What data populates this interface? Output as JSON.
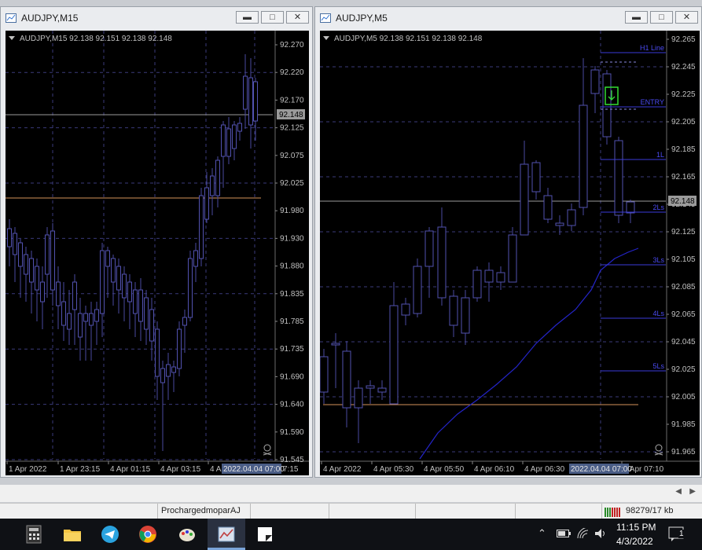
{
  "left_window": {
    "title": "AUDJPY,M15",
    "info": "AUDJPY,M15  92.138 92.151 92.138 92.148",
    "price_ticks": [
      "92.270",
      "92.220",
      "92.170",
      "92.125",
      "92.075",
      "92.025",
      "91.980",
      "91.930",
      "91.880",
      "91.835",
      "91.785",
      "91.735",
      "91.690",
      "91.640",
      "91.590",
      "91.545"
    ],
    "time_ticks": [
      "1 Apr 2022",
      "1 Apr 23:15",
      "4 Apr 01:15",
      "4 Apr 03:15",
      "4 Ap"
    ],
    "time_label_suffix": "7:15",
    "crosshair_time": "2022.04.04 07:00",
    "bid_label": "92.148"
  },
  "right_window": {
    "title": "AUDJPY,M5",
    "info": "AUDJPY,M5  92.138 92.151 92.138 92.148",
    "price_ticks": [
      "92.265",
      "92.245",
      "92.225",
      "92.205",
      "92.185",
      "92.165",
      "92.145",
      "92.125",
      "92.105",
      "92.085",
      "92.065",
      "92.045",
      "92.025",
      "92.005",
      "91.985",
      "91.965"
    ],
    "time_ticks": [
      "4 Apr 2022",
      "4 Apr 05:30",
      "4 Apr 05:50",
      "4 Apr 06:10",
      "4 Apr 06:30",
      "4 Apr 07:10"
    ],
    "crosshair_time": "2022.04.04 07:00",
    "bid_label": "92.148",
    "level_labels": [
      "H1 Line",
      "ENTRY",
      "1L",
      "2Ls",
      "3Ls",
      "4Ls",
      "5Ls"
    ]
  },
  "status_bar": {
    "user": "ProchargedmoparAJ",
    "traffic": "98279/17 kb"
  },
  "taskbar": {
    "time": "11:15 PM",
    "date": "4/3/2022",
    "notifications": "1"
  },
  "colors": {
    "candle": "#3c3c8c",
    "level": "#3a3ad8",
    "ma": "#1f1fd0",
    "orange": "#c8864a",
    "entry_box": "#33dd33"
  }
}
